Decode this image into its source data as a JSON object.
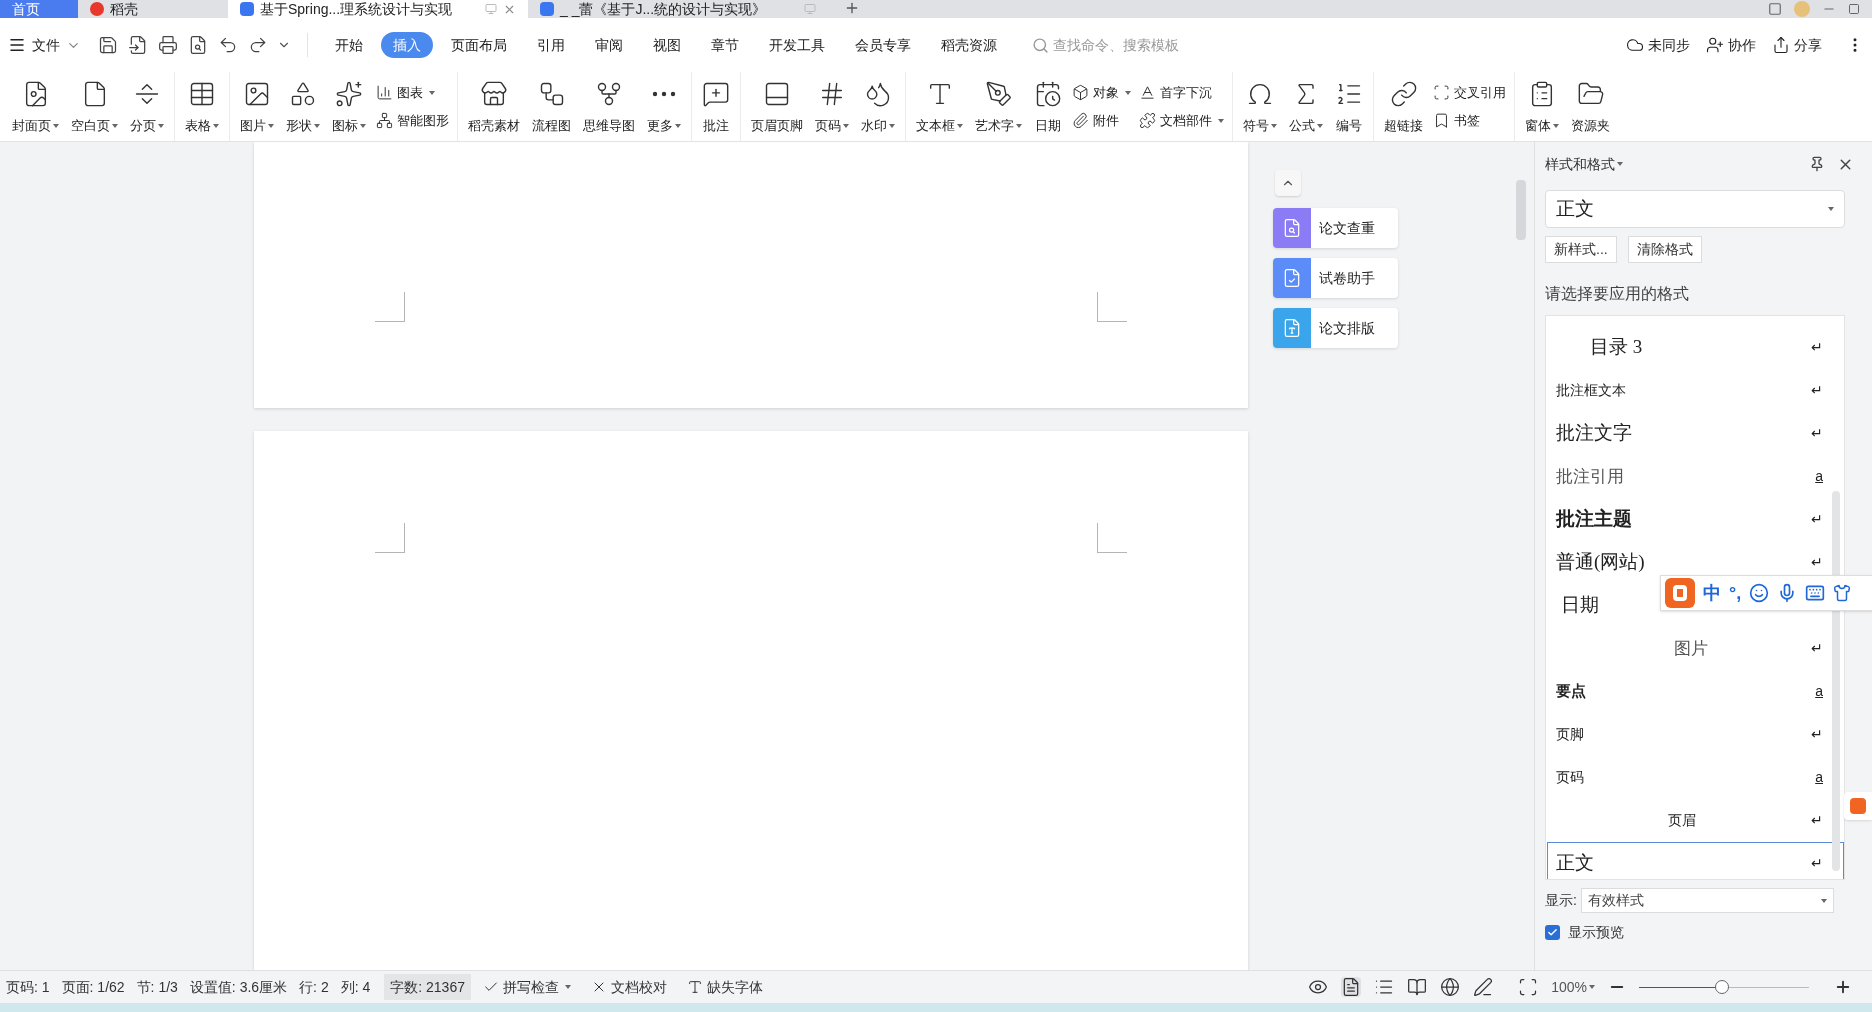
{
  "title_tabs": [
    {
      "label": "首页",
      "kind": "home",
      "selected": false
    },
    {
      "label": "稻壳",
      "kind": "shell",
      "selected": false
    },
    {
      "label": "基于Spring...理系统设计与实现",
      "kind": "doc",
      "selected": true
    },
    {
      "label": "_ _蕾《基于J...统的设计与实现》",
      "kind": "doc",
      "selected": false
    }
  ],
  "file_menu": "文件",
  "menu_tabs": [
    {
      "label": "开始",
      "selected": false
    },
    {
      "label": "插入",
      "selected": true
    },
    {
      "label": "页面布局",
      "selected": false
    },
    {
      "label": "引用",
      "selected": false
    },
    {
      "label": "审阅",
      "selected": false
    },
    {
      "label": "视图",
      "selected": false
    },
    {
      "label": "章节",
      "selected": false
    },
    {
      "label": "开发工具",
      "selected": false
    },
    {
      "label": "会员专享",
      "selected": false
    },
    {
      "label": "稻壳资源",
      "selected": false
    }
  ],
  "search": {
    "placeholder": "查找命令、搜索模板"
  },
  "header_actions": [
    "未同步",
    "协作",
    "分享"
  ],
  "ribbon": [
    {
      "items": [
        {
          "kind": "large",
          "label": "封面页",
          "dropdown": true
        },
        {
          "kind": "large",
          "label": "空白页",
          "dropdown": true
        },
        {
          "kind": "large",
          "label": "分页",
          "dropdown": true
        }
      ]
    },
    {
      "items": [
        {
          "kind": "large",
          "label": "表格",
          "dropdown": true
        }
      ]
    },
    {
      "items": [
        {
          "kind": "large",
          "label": "图片",
          "dropdown": true
        },
        {
          "kind": "large",
          "label": "形状",
          "dropdown": true
        },
        {
          "kind": "large",
          "label": "图标",
          "dropdown": true
        },
        {
          "kind": "stack",
          "rows": [
            {
              "label": "图表",
              "dropdown": true
            },
            {
              "label": "智能图形",
              "dropdown": false
            }
          ]
        }
      ]
    },
    {
      "items": [
        {
          "kind": "large",
          "label": "稻壳素材",
          "dropdown": false
        },
        {
          "kind": "large",
          "label": "流程图",
          "dropdown": false
        },
        {
          "kind": "large",
          "label": "思维导图",
          "dropdown": false
        },
        {
          "kind": "large",
          "label": "更多",
          "dropdown": true
        }
      ]
    },
    {
      "items": [
        {
          "kind": "large",
          "label": "批注",
          "dropdown": false
        }
      ]
    },
    {
      "items": [
        {
          "kind": "large",
          "label": "页眉页脚",
          "dropdown": false
        },
        {
          "kind": "large",
          "label": "页码",
          "dropdown": true
        },
        {
          "kind": "large",
          "label": "水印",
          "dropdown": true
        }
      ]
    },
    {
      "items": [
        {
          "kind": "large",
          "label": "文本框",
          "dropdown": true
        },
        {
          "kind": "large",
          "label": "艺术字",
          "dropdown": true
        },
        {
          "kind": "large",
          "label": "日期",
          "dropdown": false
        },
        {
          "kind": "stack",
          "rows": [
            {
              "label": "对象",
              "dropdown": true
            },
            {
              "label": "附件",
              "dropdown": false
            }
          ]
        },
        {
          "kind": "stack",
          "rows": [
            {
              "label": "首字下沉",
              "dropdown": false
            },
            {
              "label": "文档部件",
              "dropdown": true
            }
          ]
        }
      ]
    },
    {
      "items": [
        {
          "kind": "large",
          "label": "符号",
          "dropdown": true
        },
        {
          "kind": "large",
          "label": "公式",
          "dropdown": true
        },
        {
          "kind": "large",
          "label": "编号",
          "dropdown": false
        }
      ]
    },
    {
      "items": [
        {
          "kind": "large",
          "label": "超链接",
          "dropdown": false
        },
        {
          "kind": "stack",
          "rows": [
            {
              "label": "交叉引用",
              "dropdown": false
            },
            {
              "label": "书签",
              "dropdown": false
            }
          ]
        }
      ]
    },
    {
      "items": [
        {
          "kind": "large",
          "label": "窗体",
          "dropdown": true
        },
        {
          "kind": "large",
          "label": "资源夹",
          "dropdown": false
        }
      ]
    }
  ],
  "side_tools": [
    {
      "label": "论文查重",
      "color": "#8b7cf6"
    },
    {
      "label": "试卷助手",
      "color": "#5b8cf7"
    },
    {
      "label": "论文排版",
      "color": "#3aa5ea"
    }
  ],
  "style_panel": {
    "title": "样式和格式",
    "current_style": "正文",
    "buttons": [
      "新样式...",
      "清除格式"
    ],
    "prompt": "请选择要应用的格式",
    "styles": [
      {
        "label": "目录 3",
        "kind": "toc",
        "mark": "↵",
        "selected": false
      },
      {
        "label": "批注框文本",
        "kind": "small",
        "mark": "↵",
        "selected": false
      },
      {
        "label": "批注文字",
        "kind": "serif",
        "mark": "↵",
        "selected": false
      },
      {
        "label": "批注引用",
        "kind": "muted",
        "mark": "a",
        "selected": false
      },
      {
        "label": "批注主题",
        "kind": "heavy",
        "mark": "↵",
        "selected": false
      },
      {
        "label": "普通(网站)",
        "kind": "serif",
        "mark": "↵",
        "selected": false
      },
      {
        "label": "日期",
        "kind": "indented",
        "selected": false
      },
      {
        "label": "图片",
        "kind": "centered",
        "mark": "↵",
        "selected": false
      },
      {
        "label": "要点",
        "kind": "bold",
        "mark": "a",
        "selected": false
      },
      {
        "label": "页脚",
        "kind": "small",
        "mark": "↵",
        "selected": false
      },
      {
        "label": "页码",
        "kind": "small",
        "mark": "a",
        "selected": false
      },
      {
        "label": "页眉",
        "kind": "center-small",
        "mark": "↵",
        "selected": false
      },
      {
        "label": "正文",
        "kind": "serif",
        "mark": "↵",
        "selected": true
      }
    ],
    "show_label": "显示:",
    "show_value": "有效样式",
    "preview": {
      "label": "显示预览",
      "checked": true
    }
  },
  "ime_toolbar": {
    "labels": [
      "中",
      "°,"
    ]
  },
  "status_bar": {
    "items": [
      "页码: 1",
      "页面: 1/62",
      "节: 1/3",
      "设置值: 3.6厘米",
      "行: 2",
      "列: 4",
      "字数: 21367"
    ],
    "tools": [
      {
        "label": "拼写检查",
        "dropdown": true
      },
      {
        "label": "文档校对",
        "dropdown": false
      },
      {
        "label": "缺失字体",
        "dropdown": false
      }
    ],
    "zoom": "100%",
    "zoom_slider": {
      "level": 0.49
    }
  }
}
